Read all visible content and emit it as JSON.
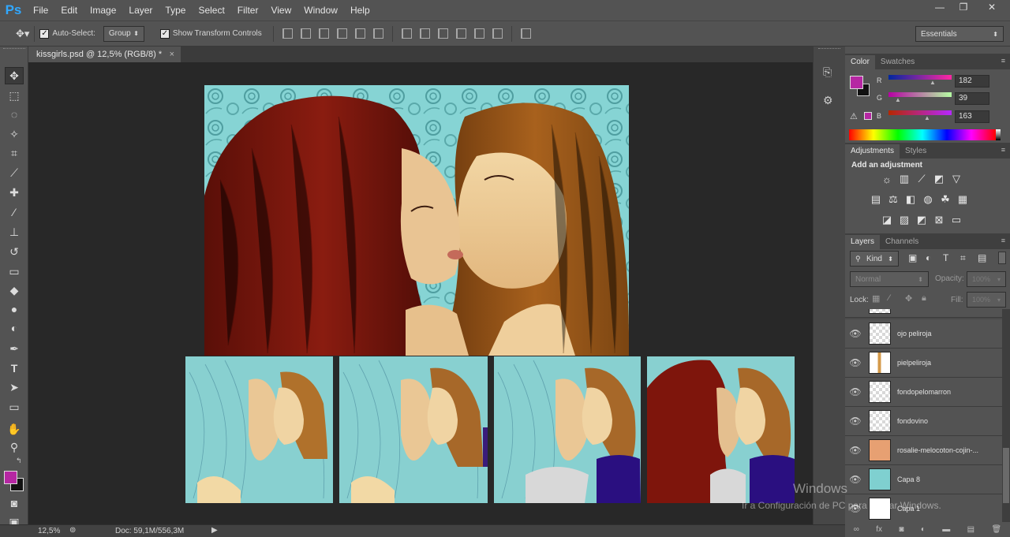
{
  "app": {
    "logo": "Ps"
  },
  "menu": [
    "File",
    "Edit",
    "Image",
    "Layer",
    "Type",
    "Select",
    "Filter",
    "View",
    "Window",
    "Help"
  ],
  "window_controls": {
    "minimize": "—",
    "restore": "❐",
    "close": "✕"
  },
  "options": {
    "auto_select_label": "Auto-Select:",
    "auto_select_checked": true,
    "auto_select_value": "Group",
    "transform_label": "Show Transform Controls",
    "transform_checked": true,
    "workspace": "Essentials"
  },
  "document": {
    "tab_title": "kissgirls.psd @ 12,5% (RGB/8) *",
    "close": "×"
  },
  "status": {
    "zoom": "12,5%",
    "doc": "Doc: 59,1M/556,3M"
  },
  "colors": {
    "foreground": "#b627a3",
    "background": "#111111",
    "canvas_bg": "#282828"
  },
  "color_panel": {
    "tabs": [
      "Color",
      "Swatches"
    ],
    "r_label": "R",
    "r_value": "182",
    "g_label": "G",
    "g_value": "39",
    "b_label": "B",
    "b_value": "163"
  },
  "adjustments": {
    "tabs": [
      "Adjustments",
      "Styles"
    ],
    "title": "Add an adjustment"
  },
  "layers": {
    "tabs": [
      "Layers",
      "Channels"
    ],
    "kind": "Kind",
    "blend_mode": "Normal",
    "opacity_label": "Opacity:",
    "opacity_value": "100%",
    "lock_label": "Lock:",
    "fill_label": "Fill:",
    "fill_value": "100%",
    "items": [
      {
        "name": "ojo peliroja"
      },
      {
        "name": "pielpeliroja"
      },
      {
        "name": "fondopelomarron"
      },
      {
        "name": "fondovino"
      },
      {
        "name": "rosalie-melocoton-cojin-..."
      },
      {
        "name": "Capa 8"
      },
      {
        "name": "Capa 1"
      }
    ]
  },
  "watermark": {
    "title": "Windows",
    "text": "Ir a Configuración de PC para activar Windows."
  }
}
